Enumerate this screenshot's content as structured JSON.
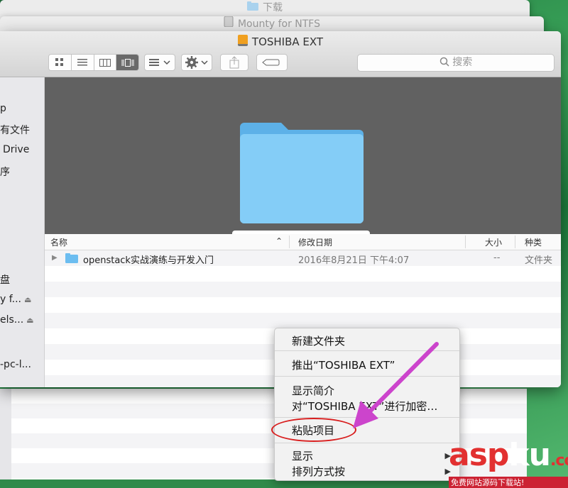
{
  "background_windows": [
    {
      "title": "下载",
      "icon": "folder-icon"
    },
    {
      "title": "Mounty for NTFS",
      "icon": "drive-icon"
    }
  ],
  "window": {
    "title": "TOSHIBA EXT",
    "title_icon": "external-drive-icon",
    "search_placeholder": "搜索"
  },
  "sidebar": {
    "items": [
      "p",
      "有文件",
      "Drive",
      "序",
      "盘",
      "y f...",
      "els...",
      "-pc-l..."
    ]
  },
  "preview": {
    "label": "openstack实战演练与开发入门"
  },
  "columns": {
    "name": "名称",
    "date": "修改日期",
    "size": "大小",
    "kind": "种类"
  },
  "files": [
    {
      "name": "openstack实战演练与开发入门",
      "date": "2016年8月21日 下午4:07",
      "size": "--",
      "kind": "文件夹"
    }
  ],
  "context_menu": {
    "new_folder": "新建文件夹",
    "eject": "推出“TOSHIBA EXT”",
    "get_info": "显示简介",
    "encrypt": "对“TOSHIBA EXT”进行加密…",
    "paste": "粘贴项目",
    "show": "显示",
    "sort_by": "排列方式按"
  },
  "colors": {
    "highlight_ring": "#d81e1e",
    "annotation_arrow": "#cc44cc",
    "folder": "#7cc6f2"
  },
  "watermark": {
    "brand_a": "asp",
    "brand_b": "ku",
    "brand_c": ".com",
    "tagline": "免费网站源码下载站!"
  }
}
